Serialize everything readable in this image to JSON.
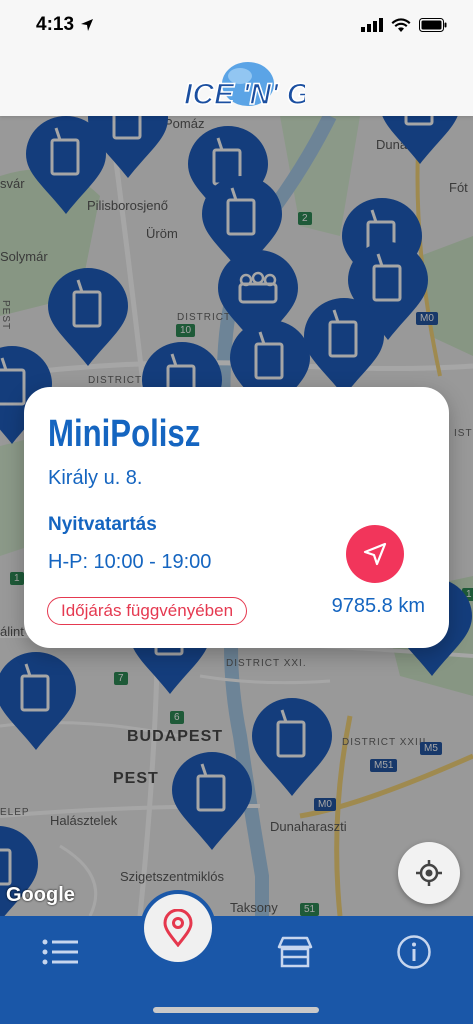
{
  "status": {
    "time": "4:13"
  },
  "app": {
    "logo_text": "ICE 'N' GO!"
  },
  "map": {
    "labels": {
      "pomaz": "Pomáz",
      "dunakeszi": "Dunakes",
      "fot": "Fót",
      "svar": "svár",
      "pilisborosjeno": "Pilisborosjenő",
      "urom": "Üröm",
      "solymar": "Solymár",
      "pest_vertical": "PEST",
      "district_1": "DISTRICT",
      "district_2": "DISTRICT",
      "district_xxi": "DISTRICT XXI.",
      "district_xxiii": "DISTRICT XXIII.",
      "alint": "álint",
      "budapest": "BUDAPEST",
      "pest": "PEST",
      "elep": "ELEP",
      "halasztelek": "Halásztelek",
      "dunaharaszti": "Dunaharaszti",
      "szigetszentmiklos": "Szigetszentmiklós",
      "taksony": "Taksony",
      "ist": "IST"
    },
    "road_badges": [
      "2",
      "10",
      "M0",
      "M5",
      "M51",
      "7",
      "6",
      "51",
      "1",
      "M0",
      "1"
    ],
    "attribution": "Google"
  },
  "card": {
    "title": "MiniPolisz",
    "address": "Király u. 8.",
    "hours_title": "Nyitvatartás",
    "hours": "H-P: 10:00 - 19:00",
    "badge": "Időjárás függvényében",
    "distance": "9785.8 km"
  },
  "colors": {
    "brand": "#1a57a8",
    "accent": "#f2355b",
    "text_blue": "#1565c0"
  },
  "tabs": [
    {
      "icon": "list-icon"
    },
    {
      "icon": "map-pin-icon",
      "active": true
    },
    {
      "icon": "store-icon"
    },
    {
      "icon": "info-icon"
    }
  ]
}
